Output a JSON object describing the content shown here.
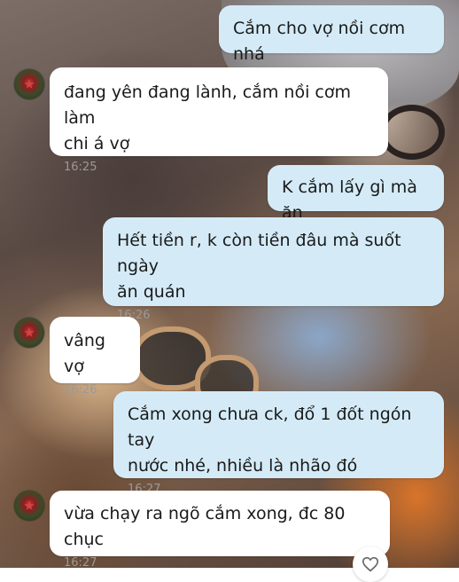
{
  "messages": [
    {
      "text": "Cắm cho vợ nồi cơm nhá",
      "time": ""
    },
    {
      "text": "đang yên đang lành, cắm nồi cơm làm\nchi á vợ",
      "time": "16:25"
    },
    {
      "text": "K cắm lấy gì mà ăn",
      "time": ""
    },
    {
      "text": "Hết tiền r, k còn tiền đâu mà suốt ngày\năn quán",
      "time": "16:26"
    },
    {
      "text": "vâng vợ",
      "time": "16:26"
    },
    {
      "text": "Cắm xong chưa ck, đổ 1 đốt ngón tay\nnước nhé, nhiều là nhão đó",
      "time": "16:27"
    },
    {
      "text": "vừa chạy ra ngõ cắm xong, đc 80 chục",
      "time": "16:27"
    }
  ],
  "icons": {
    "avatar": "contact-avatar",
    "reaction": "heart-outline-icon"
  },
  "colors": {
    "outgoing_bubble": "#d4ebf7",
    "incoming_bubble": "#ffffff",
    "timestamp": "#9a9a9a"
  }
}
